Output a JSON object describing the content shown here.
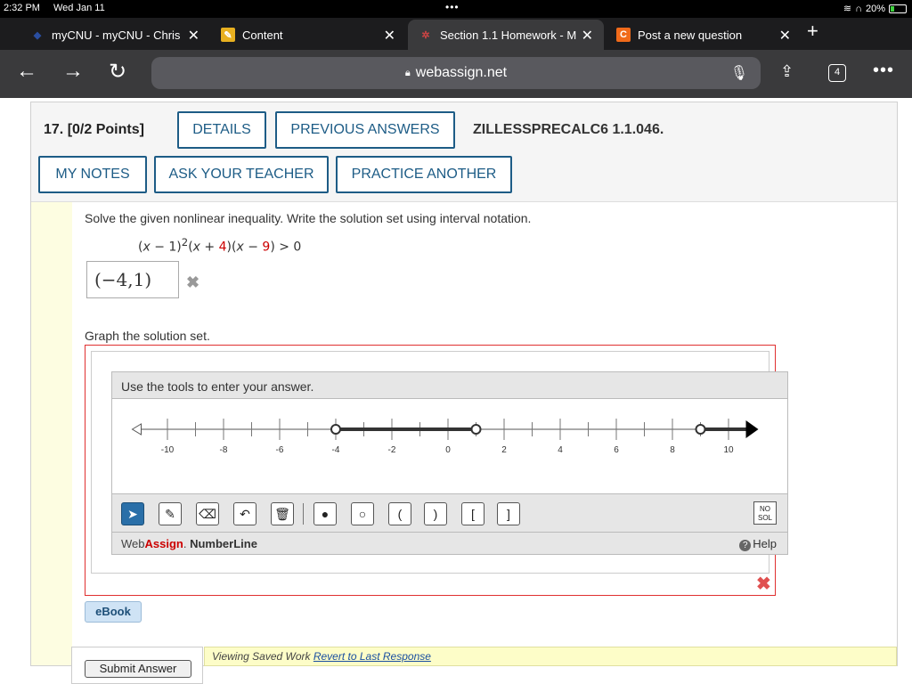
{
  "status_bar": {
    "time": "2:32 PM",
    "date": "Wed Jan 11",
    "battery": "20%",
    "battery_level": 0.2
  },
  "tabs": [
    {
      "title": "myCNU - myCNU - Chris",
      "active": false
    },
    {
      "title": "Content",
      "active": false
    },
    {
      "title": "Section 1.1 Homework - M",
      "active": true
    },
    {
      "title": "Post a new question",
      "active": false
    }
  ],
  "address": {
    "url": "webassign.net",
    "tab_count": "4"
  },
  "question": {
    "number": "17.",
    "points": "[0/2 Points]",
    "buttons": {
      "details": "DETAILS",
      "previous_answers": "PREVIOUS ANSWERS",
      "my_notes": "MY NOTES",
      "ask_teacher": "ASK YOUR TEACHER",
      "practice_another": "PRACTICE ANOTHER"
    },
    "code": "ZILLESSPRECALC6 1.1.046.",
    "prompt": "Solve the given nonlinear inequality. Write the solution set using interval notation.",
    "answer": "(−4,1)",
    "graph_label": "Graph the solution set."
  },
  "number_line": {
    "instruction": "Use the tools to enter your answer.",
    "tick_labels": [
      "-10",
      "-8",
      "-6",
      "-4",
      "-2",
      "0",
      "2",
      "4",
      "6",
      "8",
      "10"
    ],
    "range": [
      -11,
      11
    ],
    "segments": [
      {
        "from": -4,
        "to": 1,
        "from_open": true,
        "to_open": true
      }
    ],
    "rays": [
      {
        "from": 9,
        "direction": "right",
        "open": true
      }
    ],
    "brand_web": "Web",
    "brand_assign": "Assign",
    "brand_tool": "NumberLine",
    "help_label": "Help",
    "no_solution_label": "NO SOL"
  },
  "ebook_label": "eBook",
  "footer": {
    "submit_label": "Submit Answer",
    "viewing_text": "Viewing Saved Work",
    "revert_label": "Revert to Last Response"
  },
  "colors": {
    "primary_button": "#1d5c86",
    "error": "#e03030",
    "accent_red": "#cc0000"
  }
}
